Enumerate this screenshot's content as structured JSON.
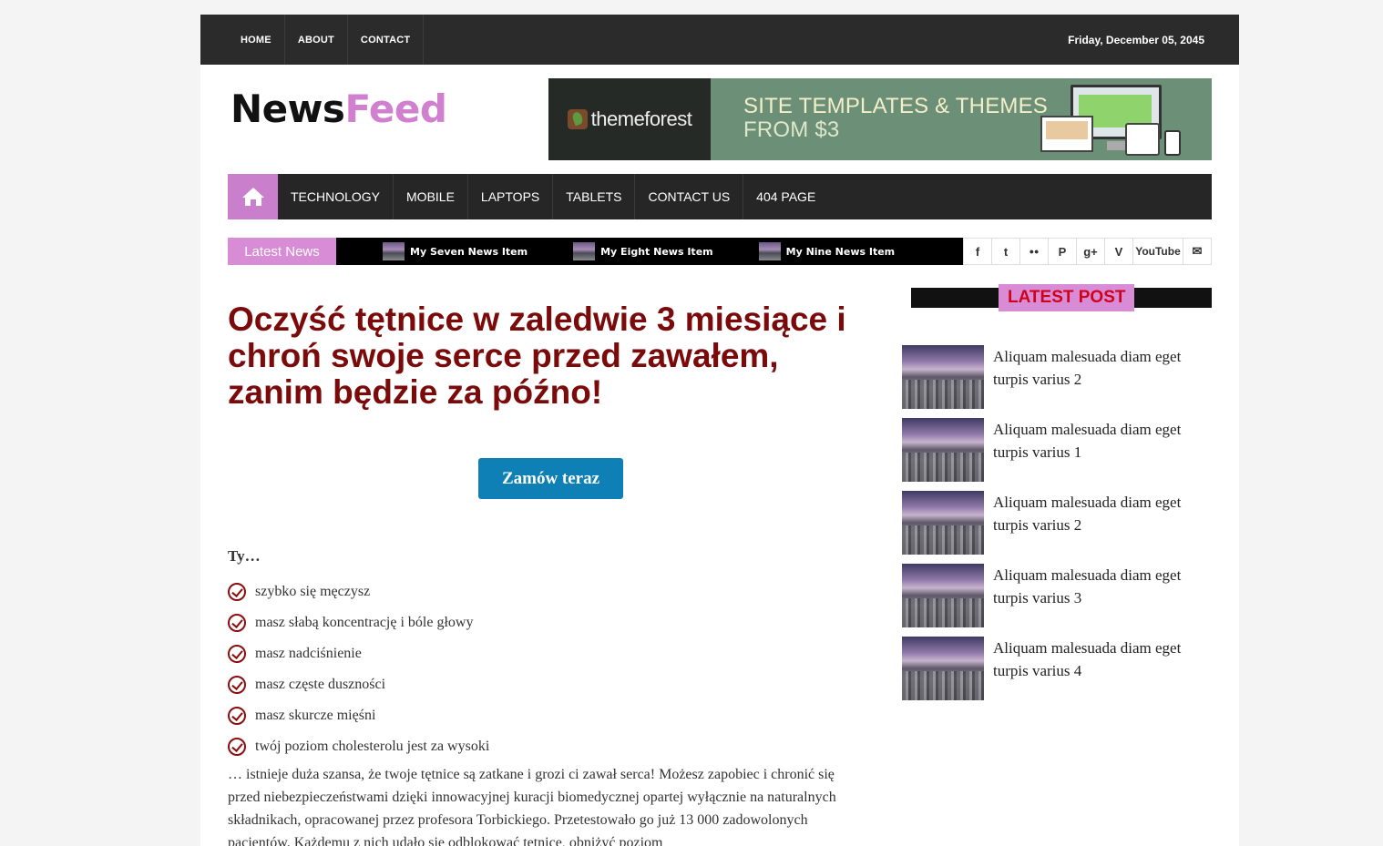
{
  "topbar": {
    "nav": [
      "HOME",
      "ABOUT",
      "CONTACT"
    ],
    "date": "Friday, December 05, 2045"
  },
  "logo": {
    "part1": "News",
    "part2": "Feed"
  },
  "banner": {
    "brand": "themeforest",
    "line1": "SITE TEMPLATES & THEMES",
    "line2": "FROM $3"
  },
  "mainnav": [
    "TECHNOLOGY",
    "MOBILE",
    "LAPTOPS",
    "TABLETS",
    "CONTACT US",
    "404 PAGE"
  ],
  "ticker": {
    "label": "Latest News",
    "items": [
      "My Seven News Item",
      "My Eight News Item",
      "My Nine News Item"
    ]
  },
  "social": [
    "f",
    "t",
    "●●",
    "P",
    "g+",
    "V",
    "YouTube",
    "✉"
  ],
  "article": {
    "headline": "Oczyść tętnice w zaledwie 3 miesiące i chroń swoje serce przed zawałem, zanim będzie za późno!",
    "cta": "Zamów teraz",
    "intro": "Ty…",
    "checks": [
      "szybko się męczysz",
      "masz słabą koncentrację i bóle głowy",
      "masz nadciśnienie",
      "masz częste duszności",
      "masz skurcze mięśni",
      "twój poziom cholesterolu jest za wysoki"
    ],
    "paragraph": "… istnieje duża szansa, że twoje tętnice są zatkane i grozi ci zawał serca! Możesz zapobiec i chronić się przed niebezpieczeństwami dzięki innowacyjnej kuracji biomedycznej opartej wyłącznie na naturalnych składnikach, opracowanej przez profesora Torbickiego. Przetestowało go już 13 000 zadowolonych pacjentów. Każdemu z nich udało się odblokować tętnice, obniżyć poziom"
  },
  "sidebar": {
    "title": "LATEST POST",
    "posts": [
      "Aliquam malesuada diam eget turpis varius 2",
      "Aliquam malesuada diam eget turpis varius 1",
      "Aliquam malesuada diam eget turpis varius 2",
      "Aliquam malesuada diam eget turpis varius 3",
      "Aliquam malesuada diam eget turpis varius 4"
    ]
  }
}
